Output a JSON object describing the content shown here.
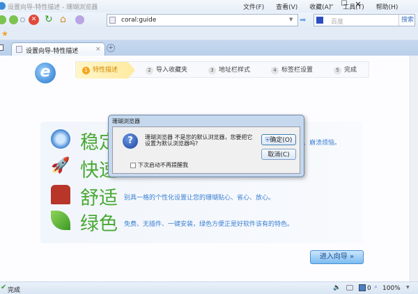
{
  "window": {
    "title": "设置向导-特性描述 - 珊瑚浏览器",
    "menu": [
      "文件(F)",
      "查看(V)",
      "收藏(A)",
      "工具(T)",
      "帮助(H)"
    ]
  },
  "toolbar": {
    "address": "coral:guide",
    "search_placeholder": "百度",
    "search_button": "搜索"
  },
  "tab": {
    "label": "设置向导-特性描述",
    "close": "×",
    "new": "+"
  },
  "steps": [
    {
      "n": "1",
      "label": "特性描述",
      "active": true
    },
    {
      "n": "2",
      "label": "导入收藏夹"
    },
    {
      "n": "3",
      "label": "地址栏样式"
    },
    {
      "n": "4",
      "label": "标签栏设置"
    },
    {
      "n": "5",
      "label": "完成"
    }
  ],
  "features": [
    {
      "title": "稳定",
      "desc": "、崩溃烦恼。"
    },
    {
      "title": "快速",
      "desc": ""
    },
    {
      "title": "舒适",
      "desc": "别具一格的个性化设置让您的珊瑚贴心、省心、放心。"
    },
    {
      "title": "绿色",
      "desc": "免费、无插件、一键安装，绿色方便正是好软件该有的特色。"
    }
  ],
  "enter_button": "进入向导 »",
  "dialog": {
    "title": "珊瑚浏览器",
    "message": "珊瑚浏览器 不是您的默认浏览器，您要把它设置为默认浏览器吗?",
    "ok": "确定(O)",
    "cancel": "取消(C)",
    "checkbox": "下次启动不再提醒我",
    "checked": false
  },
  "status": {
    "text": "完成",
    "popup_count": "0",
    "zoom": "100%"
  }
}
